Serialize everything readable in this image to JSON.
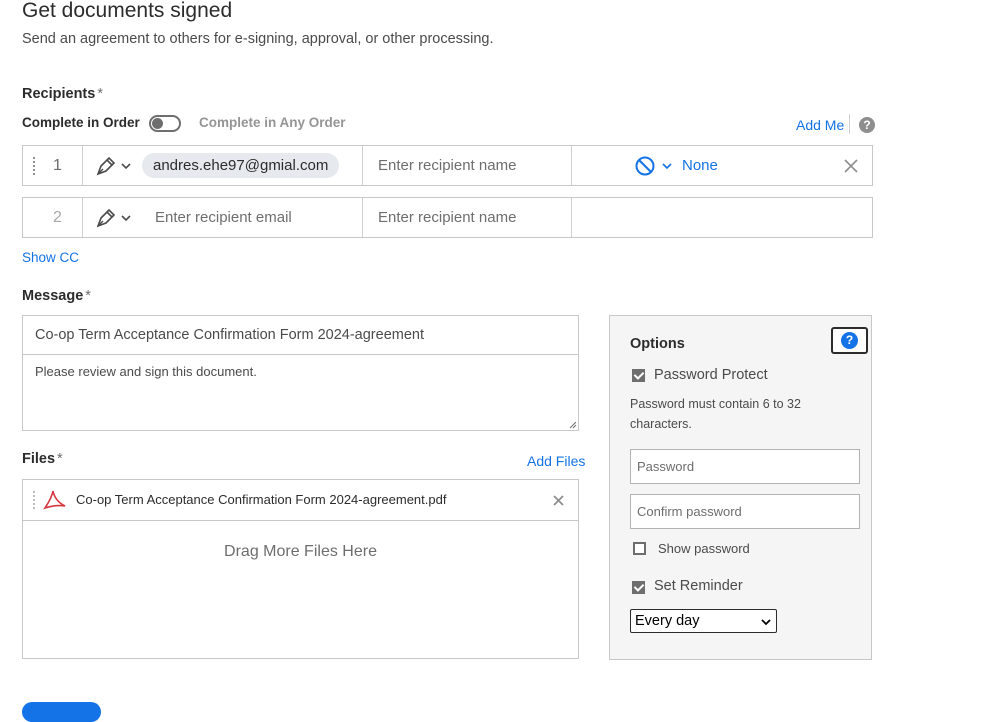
{
  "header": {
    "title": "Get documents signed",
    "subtitle": "Send an agreement to others for e-signing, approval, or other processing."
  },
  "recipients": {
    "label": "Recipients",
    "required_mark": "*",
    "order_left": "Complete in Order",
    "order_right": "Complete in Any Order",
    "add_me": "Add Me",
    "help_icon": "question-icon",
    "rows": [
      {
        "num": "1",
        "email": "andres.ehe97@gmial.com",
        "name_placeholder": "Enter recipient name",
        "auth": "None"
      },
      {
        "num": "2",
        "email_placeholder": "Enter recipient email",
        "name_placeholder": "Enter recipient name"
      }
    ],
    "show_cc": "Show CC"
  },
  "message": {
    "label": "Message",
    "required_mark": "*",
    "subject": "Co-op Term Acceptance Confirmation Form 2024-agreement",
    "body": "Please review and sign this document."
  },
  "files": {
    "label": "Files",
    "required_mark": "*",
    "add_files": "Add Files",
    "file_name": "Co-op Term Acceptance Confirmation Form 2024-agreement.pdf",
    "drop_text": "Drag More Files Here"
  },
  "options": {
    "title": "Options",
    "password_protect": "Password Protect",
    "password_hint": "Password must contain 6 to 32 characters.",
    "password_placeholder": "Password",
    "confirm_placeholder": "Confirm password",
    "show_password": "Show password",
    "set_reminder": "Set Reminder",
    "reminder_value": "Every day",
    "reminder_options": [
      "Every day"
    ]
  },
  "colors": {
    "accent": "#1473e6",
    "border": "#c8c8c8",
    "panel": "#f5f5f5"
  }
}
